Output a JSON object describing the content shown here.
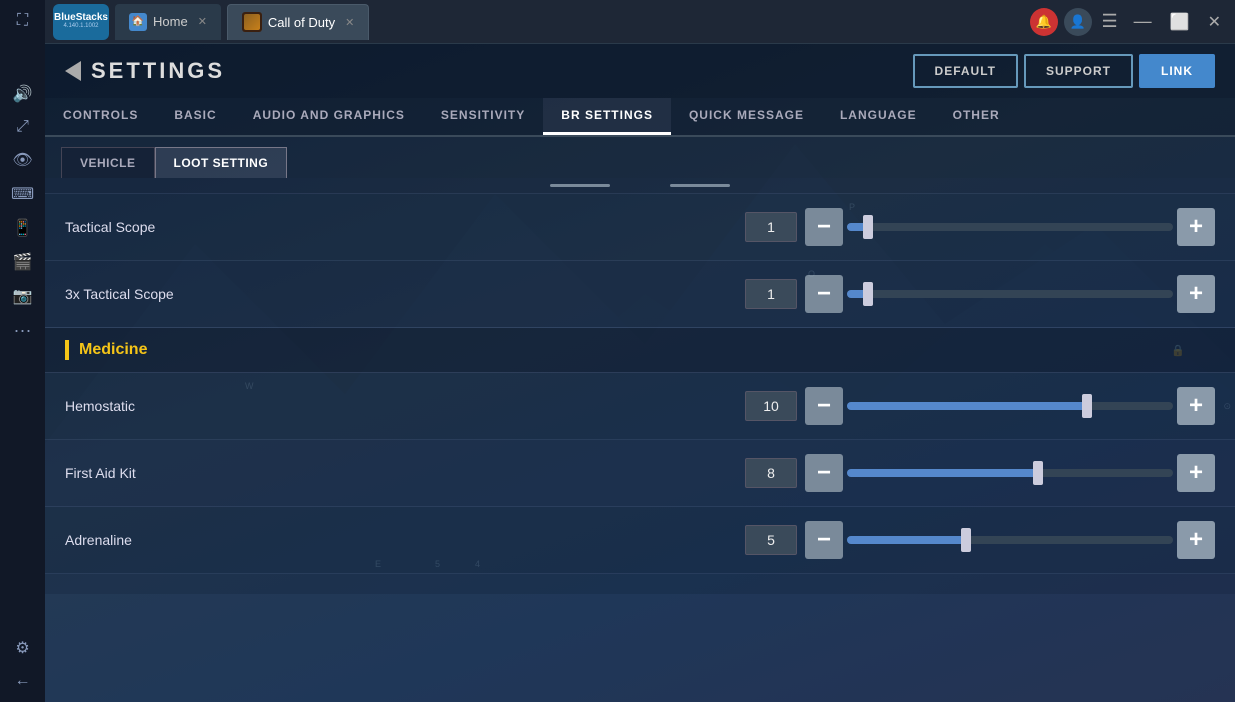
{
  "app": {
    "name": "BlueStacks",
    "version": "4.140.1.1002"
  },
  "titlebar": {
    "home_tab": "Home",
    "game_tab": "Call of Duty",
    "window_controls": {
      "minimize": "—",
      "maximize": "⬜",
      "close": "✕",
      "expand": "⛶"
    }
  },
  "header_buttons": [
    {
      "label": "DEFAULT",
      "active": false
    },
    {
      "label": "SUPPORT",
      "active": false
    },
    {
      "label": "LINK",
      "active": true
    }
  ],
  "settings_title": "SETTINGS",
  "main_tabs": [
    {
      "label": "CONTROLS",
      "active": false
    },
    {
      "label": "BASIC",
      "active": false
    },
    {
      "label": "AUDIO AND GRAPHICS",
      "active": false
    },
    {
      "label": "SENSITIVITY",
      "active": false
    },
    {
      "label": "BR SETTINGS",
      "active": true
    },
    {
      "label": "QUICK MESSAGE",
      "active": false
    },
    {
      "label": "LANGUAGE",
      "active": false
    },
    {
      "label": "OTHER",
      "active": false
    }
  ],
  "sub_tabs": [
    {
      "label": "VEHICLE",
      "active": false
    },
    {
      "label": "LOOT SETTING",
      "active": true
    }
  ],
  "sections": [
    {
      "id": "medicine",
      "title": "Medicine",
      "visible": true
    }
  ],
  "settings": [
    {
      "name": "Tactical Scope",
      "value": "1",
      "slider_percent": 8,
      "has_blue_fill": false
    },
    {
      "name": "3x Tactical Scope",
      "value": "1",
      "slider_percent": 8,
      "has_blue_fill": false
    },
    {
      "name": "Hemostatic",
      "value": "10",
      "slider_percent": 75,
      "has_blue_fill": true
    },
    {
      "name": "First Aid Kit",
      "value": "8",
      "slider_percent": 60,
      "has_blue_fill": true
    },
    {
      "name": "Adrenaline",
      "value": "5",
      "slider_percent": 38,
      "has_blue_fill": true
    }
  ],
  "scroll_indicators": {
    "top_line_1": "",
    "top_line_2": ""
  },
  "sidebar_icons": [
    "🔔",
    "👤",
    "☰",
    "⌨",
    "📱",
    "📷",
    "⋯",
    "⚙",
    "←"
  ]
}
